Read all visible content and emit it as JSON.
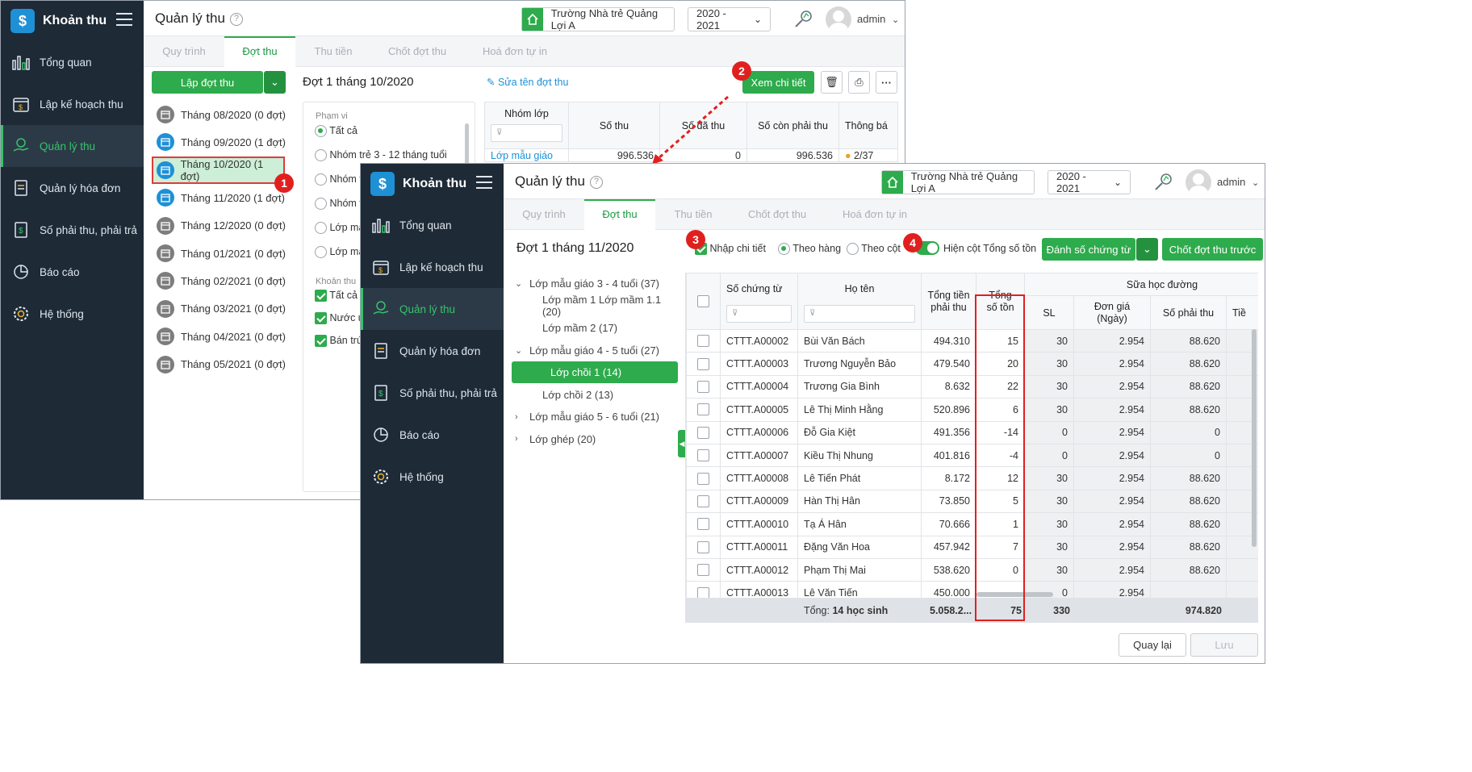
{
  "app": {
    "brand": "Khoản thu",
    "page_title": "Quản lý thu",
    "school": "Trường Nhà trẻ Quảng Lợi A",
    "year": "2020 - 2021",
    "user": "admin"
  },
  "nav": [
    "Tổng quan",
    "Lập kế hoạch thu",
    "Quản lý thu",
    "Quản lý hóa đơn",
    "Số phải thu, phải trả",
    "Báo cáo",
    "Hệ thống"
  ],
  "tabs": [
    "Quy trình",
    "Đợt thu",
    "Thu tiền",
    "Chốt đợt thu",
    "Hoá đơn tự in"
  ],
  "back": {
    "create_button": "Lập đợt thu",
    "batch_title": "Đợt 1 tháng 10/2020",
    "rename_link": "Sửa tên đợt thu",
    "detail_button": "Xem chi tiết",
    "months": [
      {
        "label": "Tháng 08/2020 (0 đợt)",
        "active": false
      },
      {
        "label": "Tháng 09/2020 (1 đợt)",
        "active": true
      },
      {
        "label": "Tháng 10/2020 (1 đợt)",
        "active": true
      },
      {
        "label": "Tháng 11/2020 (1 đợt)",
        "active": true
      },
      {
        "label": "Tháng 12/2020 (0 đợt)",
        "active": false
      },
      {
        "label": "Tháng 01/2021 (0 đợt)",
        "active": false
      },
      {
        "label": "Tháng 02/2021 (0 đợt)",
        "active": false
      },
      {
        "label": "Tháng 03/2021 (0 đợt)",
        "active": false
      },
      {
        "label": "Tháng 04/2021 (0 đợt)",
        "active": false
      },
      {
        "label": "Tháng 05/2021 (0 đợt)",
        "active": false
      }
    ],
    "filter_scope_label": "Phạm vi",
    "scope_options": [
      "Tất cả",
      "Nhóm trẻ 3 - 12 tháng tuổi",
      "Nhóm t",
      "Nhóm t",
      "Lớp mẫ",
      "Lớp mẫ"
    ],
    "fee_label": "Khoản thu",
    "fee_options": [
      "Tất cả",
      "Nước u",
      "Bán trú"
    ],
    "table_headers": [
      "Nhóm lớp",
      "Số thu",
      "Số đã thu",
      "Số còn phải thu",
      "Thông bá"
    ],
    "table_row": [
      "Lớp mẫu giáo",
      "996.536",
      "0",
      "996.536",
      "2/37"
    ]
  },
  "front": {
    "batch_title": "Đợt 1 tháng 11/2020",
    "opt_detail": "Nhập chi tiết",
    "opt_row": "Theo hàng",
    "opt_col": "Theo cột",
    "toggle_label": "Hiện cột Tổng số tồn",
    "number_button": "Đánh số chứng từ",
    "close_prev_button": "Chốt đợt thu trước",
    "tree": [
      {
        "label": "Lớp mẫu giáo 3 - 4 tuổi (37)",
        "level": 0,
        "arrow": "v"
      },
      {
        "label": "Lớp mầm 1 Lớp mầm 1.1 (20)",
        "level": 1,
        "arrow": ""
      },
      {
        "label": "Lớp mầm 2 (17)",
        "level": 1,
        "arrow": ""
      },
      {
        "label": "Lớp mẫu giáo 4 - 5 tuổi (27)",
        "level": 0,
        "arrow": "v"
      },
      {
        "label": "Lớp chồi 1 (14)",
        "level": 1,
        "arrow": "",
        "selected": true
      },
      {
        "label": "Lớp chồi 2 (13)",
        "level": 1,
        "arrow": ""
      },
      {
        "label": "Lớp mẫu giáo 5 - 6 tuổi (21)",
        "level": 0,
        "arrow": ">"
      },
      {
        "label": "Lớp ghép (20)",
        "level": 0,
        "arrow": ">"
      }
    ],
    "headers": {
      "doc_no": "Số chứng từ",
      "name": "Họ tên",
      "total": "Tổng tiền phải thu",
      "stock": "Tổng số tồn",
      "group": "Sữa học đường",
      "qty": "SL",
      "price": "Đơn giá (Ngày)",
      "due": "Số phải thu",
      "cut": "Tiề"
    },
    "rows": [
      {
        "doc": "CTTT.A00002",
        "name": "Bùi Văn Bách",
        "total": "494.310",
        "stock": "15",
        "qty": "30",
        "price": "2.954",
        "due": "88.620"
      },
      {
        "doc": "CTTT.A00003",
        "name": "Trương Nguyễn Bảo",
        "total": "479.540",
        "stock": "20",
        "qty": "30",
        "price": "2.954",
        "due": "88.620"
      },
      {
        "doc": "CTTT.A00004",
        "name": "Trương Gia Bình",
        "total": "8.632",
        "stock": "22",
        "qty": "30",
        "price": "2.954",
        "due": "88.620"
      },
      {
        "doc": "CTTT.A00005",
        "name": "Lê Thị Minh Hằng",
        "total": "520.896",
        "stock": "6",
        "qty": "30",
        "price": "2.954",
        "due": "88.620"
      },
      {
        "doc": "CTTT.A00006",
        "name": "Đỗ Gia Kiệt",
        "total": "491.356",
        "stock": "-14",
        "qty": "0",
        "price": "2.954",
        "due": "0"
      },
      {
        "doc": "CTTT.A00007",
        "name": "Kiều Thị Nhung",
        "total": "401.816",
        "stock": "-4",
        "qty": "0",
        "price": "2.954",
        "due": "0"
      },
      {
        "doc": "CTTT.A00008",
        "name": "Lê Tiến Phát",
        "total": "8.172",
        "stock": "12",
        "qty": "30",
        "price": "2.954",
        "due": "88.620"
      },
      {
        "doc": "CTTT.A00009",
        "name": "Hàn Thị Hân",
        "total": "73.850",
        "stock": "5",
        "qty": "30",
        "price": "2.954",
        "due": "88.620"
      },
      {
        "doc": "CTTT.A00010",
        "name": "Tạ Á Hân",
        "total": "70.666",
        "stock": "1",
        "qty": "30",
        "price": "2.954",
        "due": "88.620"
      },
      {
        "doc": "CTTT.A00011",
        "name": "Đặng Văn Hoa",
        "total": "457.942",
        "stock": "7",
        "qty": "30",
        "price": "2.954",
        "due": "88.620"
      },
      {
        "doc": "CTTT.A00012",
        "name": "Phạm Thị Mai",
        "total": "538.620",
        "stock": "0",
        "qty": "30",
        "price": "2.954",
        "due": "88.620"
      },
      {
        "doc": "CTTT.A00013",
        "name": "Lê Văn Tiến",
        "total": "450.000",
        "stock": "",
        "qty": "0",
        "price": "2.954",
        "due": ""
      }
    ],
    "footer": {
      "label": "Tổng:",
      "count": "14 học sinh",
      "total": "5.058.2...",
      "stock": "75",
      "qty": "330",
      "due": "974.820"
    },
    "back_button": "Quay lại",
    "save_button": "Lưu"
  },
  "callouts": [
    "1",
    "2",
    "3",
    "4"
  ],
  "colors": {
    "green": "#2eab4c",
    "sidebar": "#1e2a36",
    "red": "#e0201f",
    "blue": "#1e90d6"
  }
}
